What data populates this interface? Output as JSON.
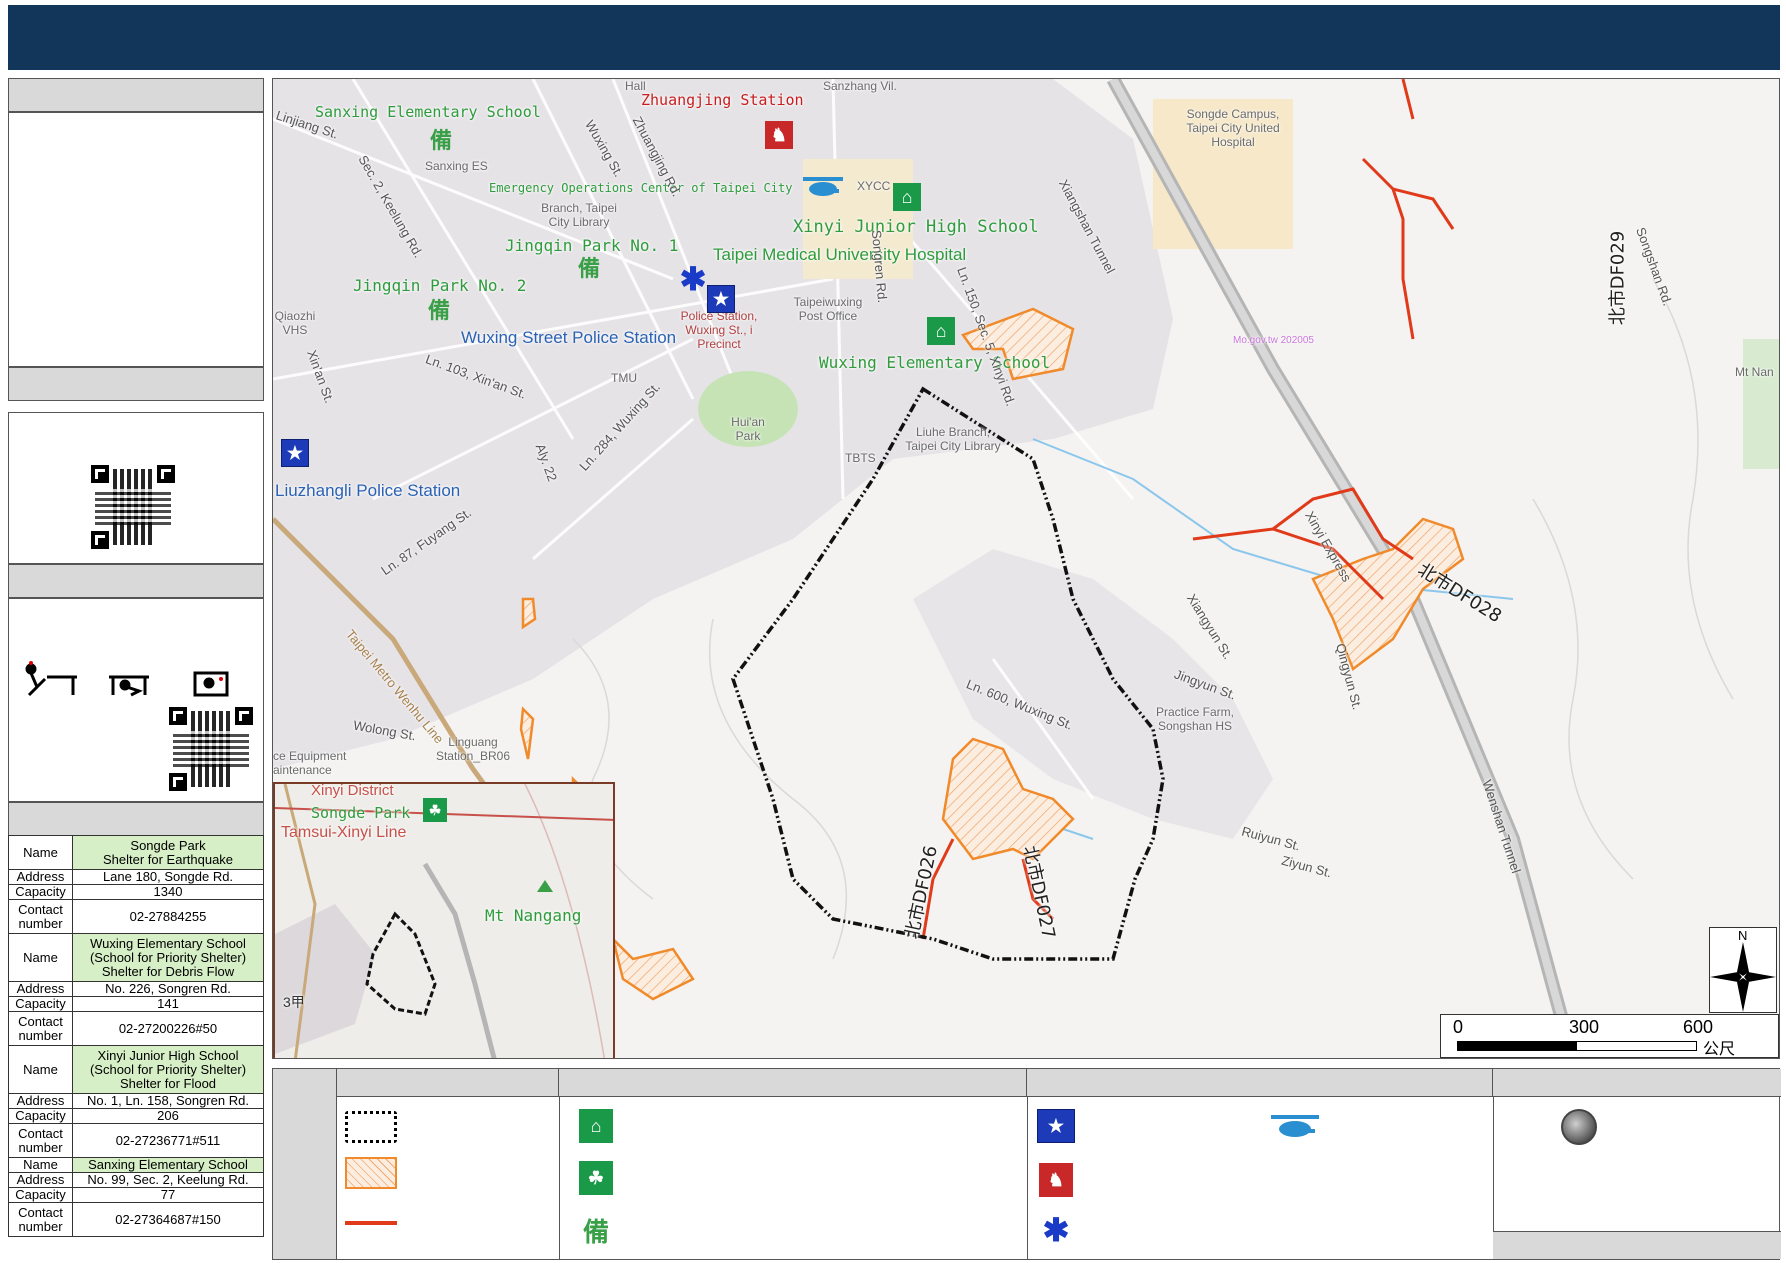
{
  "map": {
    "place_labels": [
      {
        "key": "sanxing_es",
        "text": "Sanxing Elementary School",
        "color": "green"
      },
      {
        "key": "zhuangjing",
        "text": "Zhuangjing Station",
        "color": "red"
      },
      {
        "key": "eoc",
        "text": "Emergency Operations Center of Taipei City",
        "color": "green"
      },
      {
        "key": "xinyi_jhs",
        "text": "Xinyi Junior High School",
        "color": "green"
      },
      {
        "key": "jingqin1",
        "text": "Jingqin Park No. 1",
        "color": "green"
      },
      {
        "key": "tmuh",
        "text": "Taipei Medical University Hospital",
        "color": "green"
      },
      {
        "key": "jingqin2",
        "text": "Jingqin Park No. 2",
        "color": "green"
      },
      {
        "key": "wuxing_police",
        "text": "Wuxing Street Police Station",
        "color": "blue"
      },
      {
        "key": "wuxing_es",
        "text": "Wuxing Elementary School",
        "color": "green"
      },
      {
        "key": "liuzhangli",
        "text": "Liuzhangli Police Station",
        "color": "blue"
      }
    ],
    "base_labels": [
      "Hall",
      "Sanzhang Vil.",
      "Songde Campus, Taipei City United Hospital",
      "Sanxing ES",
      "Branch, Taipei City Library",
      "XYCC",
      "Taipeiwuxing Post Office",
      "Qiaozhi VHS",
      "TMU",
      "Hui'an Park",
      "Liuhe Branch, Taipei City Library",
      "TBTS",
      "Practice Farm, Songshan HS",
      "Linguang Station_BR06",
      "ce Equipment aintenance",
      "Mt Nan",
      "Police Station, Wuxing St., i Precinct"
    ],
    "road_labels": [
      "Linjiang St.",
      "Sec. 2, Keelung Rd.",
      "Wuxing St.",
      "Zhuangjing Rd.",
      "Songren Rd.",
      "Xiangshan Tunnel",
      "Ln. 150, Sec. 5, Xinyi Rd.",
      "Xin'an St.",
      "Ln. 103, Xin'an St.",
      "Ln. 284, Wuxing St.",
      "Aly. 22",
      "Ln. 87, Fuyang St.",
      "Taipei Metro Wenhu Line",
      "Wolong St.",
      "Xinyi Express",
      "Xiangyun St.",
      "Jingyun St.",
      "Qingyun St.",
      "Ln. 600, Wuxing St.",
      "Ruiyun St.",
      "Ziyun St.",
      "Wenshan Tunnel",
      "Songshan Rd.",
      "Mo.gov.tw 202005"
    ],
    "debris_labels": [
      "北市DF029",
      "北市DF028",
      "北市DF026",
      "北市DF027"
    ],
    "inset": {
      "labels": [
        "Xinyi District",
        "Songde Park",
        "Tamsui-Xinyi Line",
        "Mt Nangang",
        "3甲"
      ]
    },
    "scale": {
      "ticks": [
        "0",
        "300",
        "600"
      ],
      "unit": "公尺"
    },
    "north": "N"
  },
  "shelters": [
    {
      "name_label": "Name",
      "name": "Songde Park\nShelter for Earthquake",
      "address_label": "Address",
      "address": "Lane 180, Songde Rd.",
      "capacity_label": "Capacity",
      "capacity": "1340",
      "contact_label": "Contact number",
      "contact": "02-27884255"
    },
    {
      "name_label": "Name",
      "name": "Wuxing Elementary School\n(School for Priority Shelter)\nShelter for Debris Flow",
      "address_label": "Address",
      "address": "No. 226, Songren Rd.",
      "capacity_label": "Capacity",
      "capacity": "141",
      "contact_label": "Contact number",
      "contact": "02-27200226#50"
    },
    {
      "name_label": "Name",
      "name": "Xinyi Junior High School\n(School for Priority Shelter)\nShelter for Flood",
      "address_label": "Address",
      "address": "No. 1, Ln. 158, Songren Rd.",
      "capacity_label": "Capacity",
      "capacity": "206",
      "contact_label": "Contact number",
      "contact": "02-27236771#511"
    },
    {
      "name_label": "Name",
      "name": "Sanxing Elementary School",
      "address_label": "Address",
      "address": "No. 99, Sec. 2, Keelung Rd.",
      "capacity_label": "Capacity",
      "capacity": "77",
      "contact_label": "Contact number",
      "contact": "02-27364687#150"
    }
  ],
  "colors": {
    "header": "#12365a",
    "debris_area": "#f08a2a",
    "debris_stream": "#e03a1a",
    "shelter_green": "#1a9a48",
    "police_blue": "#1d3bb8"
  },
  "icons": [
    "boundary-dotted-icon",
    "debris-area-hatch-icon",
    "debris-stream-line-icon",
    "shelter-icon",
    "park-shelter-icon",
    "reserve-shelter-icon",
    "police-icon",
    "fire-station-icon",
    "medical-icon",
    "helicopter-icon",
    "hydrant-icon"
  ]
}
